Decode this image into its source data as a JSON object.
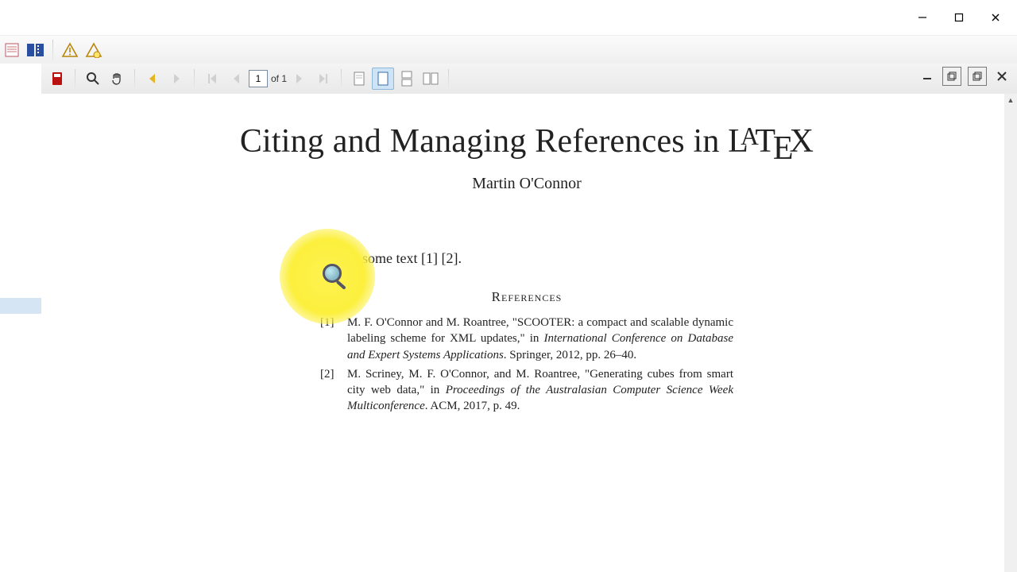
{
  "window": {
    "min": "Minimize",
    "max": "Maximize",
    "close": "Close"
  },
  "pdf_toolbar": {
    "page_value": "1",
    "page_of": "of 1"
  },
  "doc": {
    "title_prefix": "Citing and Managing References in ",
    "author": "Martin O'Connor",
    "intro": "This is some text [1] [2].",
    "refs_heading": "References",
    "refs": [
      {
        "num": "[1]",
        "pre": "M. F. O'Connor and M. Roantree, \"SCOOTER: a compact and scalable dynamic labeling scheme for XML updates,\" in ",
        "ital": "International Conference on Database and Expert Systems Applications",
        "post": ".   Springer, 2012, pp. 26–40."
      },
      {
        "num": "[2]",
        "pre": "M. Scriney, M. F. O'Connor, and M. Roantree, \"Generating cubes from smart city web data,\" in ",
        "ital": "Proceedings of the Australasian Computer Science Week Multiconference",
        "post": ".   ACM, 2017, p. 49."
      }
    ]
  }
}
